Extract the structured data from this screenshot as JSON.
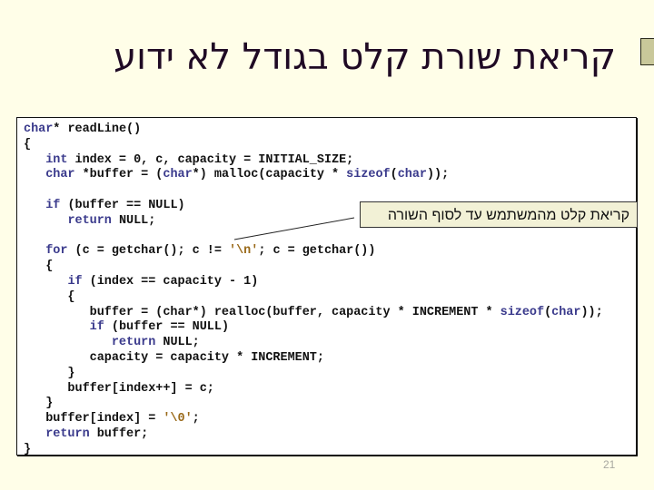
{
  "slide": {
    "title": "קריאת שורת קלט בגודל לא ידוע",
    "page_number": "21",
    "callout_text": "קריאת קלט מהמשתמש עד לסוף השורה",
    "colors": {
      "background": "#fffee8",
      "keyword": "#3a3a8c",
      "char_literal": "#9a6a1a",
      "callout_fill": "#f2f1d6",
      "bullet_fill": "#c9c89a"
    }
  },
  "code": {
    "lines": [
      [
        {
          "t": "char",
          "k": "kw"
        },
        {
          "t": "* readLine()"
        }
      ],
      [
        {
          "t": "{"
        }
      ],
      [
        {
          "t": "   "
        },
        {
          "t": "int",
          "k": "kw"
        },
        {
          "t": " index = 0, c, capacity = INITIAL_SIZE;"
        }
      ],
      [
        {
          "t": "   "
        },
        {
          "t": "char",
          "k": "kw"
        },
        {
          "t": " *buffer = ("
        },
        {
          "t": "char",
          "k": "kw"
        },
        {
          "t": "*) malloc(capacity * "
        },
        {
          "t": "sizeof",
          "k": "kw"
        },
        {
          "t": "("
        },
        {
          "t": "char",
          "k": "kw"
        },
        {
          "t": "));"
        }
      ],
      [
        {
          "t": ""
        }
      ],
      [
        {
          "t": "   "
        },
        {
          "t": "if",
          "k": "kw"
        },
        {
          "t": " (buffer == NULL)"
        }
      ],
      [
        {
          "t": "      "
        },
        {
          "t": "return",
          "k": "kw"
        },
        {
          "t": " NULL;"
        }
      ],
      [
        {
          "t": ""
        }
      ],
      [
        {
          "t": "   "
        },
        {
          "t": "for",
          "k": "kw"
        },
        {
          "t": " (c = getchar(); c != "
        },
        {
          "t": "'\\n'",
          "k": "str"
        },
        {
          "t": "; c = getchar())"
        }
      ],
      [
        {
          "t": "   {"
        }
      ],
      [
        {
          "t": "      "
        },
        {
          "t": "if",
          "k": "kw"
        },
        {
          "t": " (index == capacity - 1)"
        }
      ],
      [
        {
          "t": "      {"
        }
      ],
      [
        {
          "t": "         buffer = (char*) realloc(buffer, capacity * INCREMENT * "
        },
        {
          "t": "sizeof",
          "k": "kw"
        },
        {
          "t": "("
        },
        {
          "t": "char",
          "k": "kw"
        },
        {
          "t": "));"
        }
      ],
      [
        {
          "t": "         "
        },
        {
          "t": "if",
          "k": "kw"
        },
        {
          "t": " (buffer == NULL)"
        }
      ],
      [
        {
          "t": "            "
        },
        {
          "t": "return",
          "k": "kw"
        },
        {
          "t": " NULL;"
        }
      ],
      [
        {
          "t": "         capacity = capacity * INCREMENT;"
        }
      ],
      [
        {
          "t": "      }"
        }
      ],
      [
        {
          "t": "      buffer[index++] = c;"
        }
      ],
      [
        {
          "t": "   }"
        }
      ],
      [
        {
          "t": "   buffer[index] = "
        },
        {
          "t": "'\\0'",
          "k": "str"
        },
        {
          "t": ";"
        }
      ],
      [
        {
          "t": "   "
        },
        {
          "t": "return",
          "k": "kw"
        },
        {
          "t": " buffer;"
        }
      ],
      [
        {
          "t": "}"
        }
      ]
    ]
  }
}
